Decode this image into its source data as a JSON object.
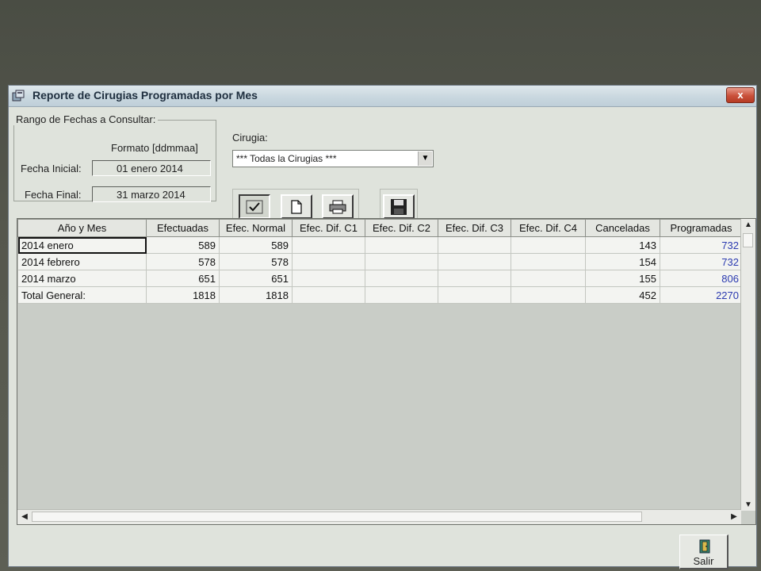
{
  "window": {
    "title": "Reporte de Cirugias Programadas por Mes",
    "close_label": "x"
  },
  "date_range": {
    "legend": "Rango de Fechas a Consultar:",
    "format_label": "Formato [ddmmaa]",
    "start_label": "Fecha Inicial:",
    "start_value": "01 enero 2014",
    "end_label": "Fecha Final:",
    "end_value": "31 marzo 2014"
  },
  "surgery": {
    "label": "Cirugia:",
    "selected": "*** Todas la Cirugias ***"
  },
  "toolbar": {
    "icons": [
      "check-icon",
      "new-document-icon",
      "print-icon",
      "save-icon"
    ]
  },
  "table": {
    "headers": [
      "Año y Mes",
      "Efectuadas",
      "Efec. Normal",
      "Efec. Dif. C1",
      "Efec. Dif. C2",
      "Efec. Dif. C3",
      "Efec. Dif. C4",
      "Canceladas",
      "Programadas"
    ],
    "rows": [
      [
        "2014 enero",
        "589",
        "589",
        "",
        "",
        "",
        "",
        "143",
        "732"
      ],
      [
        "2014 febrero",
        "578",
        "578",
        "",
        "",
        "",
        "",
        "154",
        "732"
      ],
      [
        "2014 marzo",
        "651",
        "651",
        "",
        "",
        "",
        "",
        "155",
        "806"
      ],
      [
        "Total General:",
        "1818",
        "1818",
        "",
        "",
        "",
        "",
        "452",
        "2270"
      ]
    ],
    "programadas_color": "#2b3ab0"
  },
  "exit_button": {
    "label": "Salir"
  }
}
